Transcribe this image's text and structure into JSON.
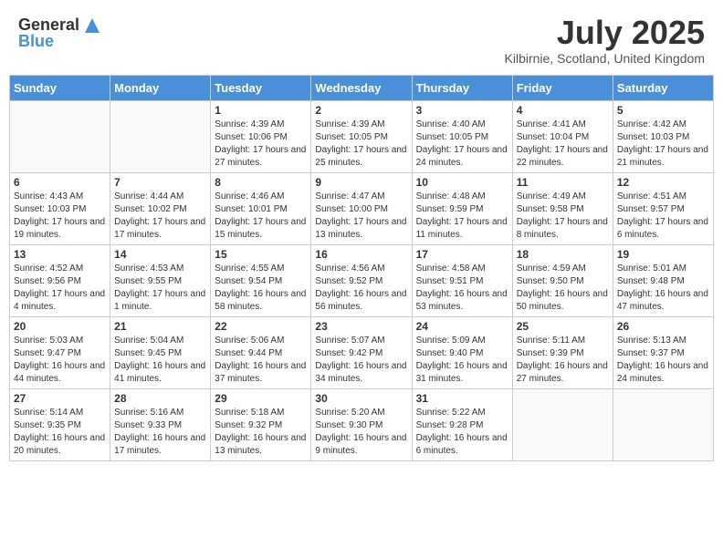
{
  "header": {
    "logo_general": "General",
    "logo_blue": "Blue",
    "month_title": "July 2025",
    "location": "Kilbirnie, Scotland, United Kingdom"
  },
  "days_of_week": [
    "Sunday",
    "Monday",
    "Tuesday",
    "Wednesday",
    "Thursday",
    "Friday",
    "Saturday"
  ],
  "weeks": [
    [
      {
        "day": "",
        "info": ""
      },
      {
        "day": "",
        "info": ""
      },
      {
        "day": "1",
        "info": "Sunrise: 4:39 AM\nSunset: 10:06 PM\nDaylight: 17 hours and 27 minutes."
      },
      {
        "day": "2",
        "info": "Sunrise: 4:39 AM\nSunset: 10:05 PM\nDaylight: 17 hours and 25 minutes."
      },
      {
        "day": "3",
        "info": "Sunrise: 4:40 AM\nSunset: 10:05 PM\nDaylight: 17 hours and 24 minutes."
      },
      {
        "day": "4",
        "info": "Sunrise: 4:41 AM\nSunset: 10:04 PM\nDaylight: 17 hours and 22 minutes."
      },
      {
        "day": "5",
        "info": "Sunrise: 4:42 AM\nSunset: 10:03 PM\nDaylight: 17 hours and 21 minutes."
      }
    ],
    [
      {
        "day": "6",
        "info": "Sunrise: 4:43 AM\nSunset: 10:03 PM\nDaylight: 17 hours and 19 minutes."
      },
      {
        "day": "7",
        "info": "Sunrise: 4:44 AM\nSunset: 10:02 PM\nDaylight: 17 hours and 17 minutes."
      },
      {
        "day": "8",
        "info": "Sunrise: 4:46 AM\nSunset: 10:01 PM\nDaylight: 17 hours and 15 minutes."
      },
      {
        "day": "9",
        "info": "Sunrise: 4:47 AM\nSunset: 10:00 PM\nDaylight: 17 hours and 13 minutes."
      },
      {
        "day": "10",
        "info": "Sunrise: 4:48 AM\nSunset: 9:59 PM\nDaylight: 17 hours and 11 minutes."
      },
      {
        "day": "11",
        "info": "Sunrise: 4:49 AM\nSunset: 9:58 PM\nDaylight: 17 hours and 8 minutes."
      },
      {
        "day": "12",
        "info": "Sunrise: 4:51 AM\nSunset: 9:57 PM\nDaylight: 17 hours and 6 minutes."
      }
    ],
    [
      {
        "day": "13",
        "info": "Sunrise: 4:52 AM\nSunset: 9:56 PM\nDaylight: 17 hours and 4 minutes."
      },
      {
        "day": "14",
        "info": "Sunrise: 4:53 AM\nSunset: 9:55 PM\nDaylight: 17 hours and 1 minute."
      },
      {
        "day": "15",
        "info": "Sunrise: 4:55 AM\nSunset: 9:54 PM\nDaylight: 16 hours and 58 minutes."
      },
      {
        "day": "16",
        "info": "Sunrise: 4:56 AM\nSunset: 9:52 PM\nDaylight: 16 hours and 56 minutes."
      },
      {
        "day": "17",
        "info": "Sunrise: 4:58 AM\nSunset: 9:51 PM\nDaylight: 16 hours and 53 minutes."
      },
      {
        "day": "18",
        "info": "Sunrise: 4:59 AM\nSunset: 9:50 PM\nDaylight: 16 hours and 50 minutes."
      },
      {
        "day": "19",
        "info": "Sunrise: 5:01 AM\nSunset: 9:48 PM\nDaylight: 16 hours and 47 minutes."
      }
    ],
    [
      {
        "day": "20",
        "info": "Sunrise: 5:03 AM\nSunset: 9:47 PM\nDaylight: 16 hours and 44 minutes."
      },
      {
        "day": "21",
        "info": "Sunrise: 5:04 AM\nSunset: 9:45 PM\nDaylight: 16 hours and 41 minutes."
      },
      {
        "day": "22",
        "info": "Sunrise: 5:06 AM\nSunset: 9:44 PM\nDaylight: 16 hours and 37 minutes."
      },
      {
        "day": "23",
        "info": "Sunrise: 5:07 AM\nSunset: 9:42 PM\nDaylight: 16 hours and 34 minutes."
      },
      {
        "day": "24",
        "info": "Sunrise: 5:09 AM\nSunset: 9:40 PM\nDaylight: 16 hours and 31 minutes."
      },
      {
        "day": "25",
        "info": "Sunrise: 5:11 AM\nSunset: 9:39 PM\nDaylight: 16 hours and 27 minutes."
      },
      {
        "day": "26",
        "info": "Sunrise: 5:13 AM\nSunset: 9:37 PM\nDaylight: 16 hours and 24 minutes."
      }
    ],
    [
      {
        "day": "27",
        "info": "Sunrise: 5:14 AM\nSunset: 9:35 PM\nDaylight: 16 hours and 20 minutes."
      },
      {
        "day": "28",
        "info": "Sunrise: 5:16 AM\nSunset: 9:33 PM\nDaylight: 16 hours and 17 minutes."
      },
      {
        "day": "29",
        "info": "Sunrise: 5:18 AM\nSunset: 9:32 PM\nDaylight: 16 hours and 13 minutes."
      },
      {
        "day": "30",
        "info": "Sunrise: 5:20 AM\nSunset: 9:30 PM\nDaylight: 16 hours and 9 minutes."
      },
      {
        "day": "31",
        "info": "Sunrise: 5:22 AM\nSunset: 9:28 PM\nDaylight: 16 hours and 6 minutes."
      },
      {
        "day": "",
        "info": ""
      },
      {
        "day": "",
        "info": ""
      }
    ]
  ]
}
